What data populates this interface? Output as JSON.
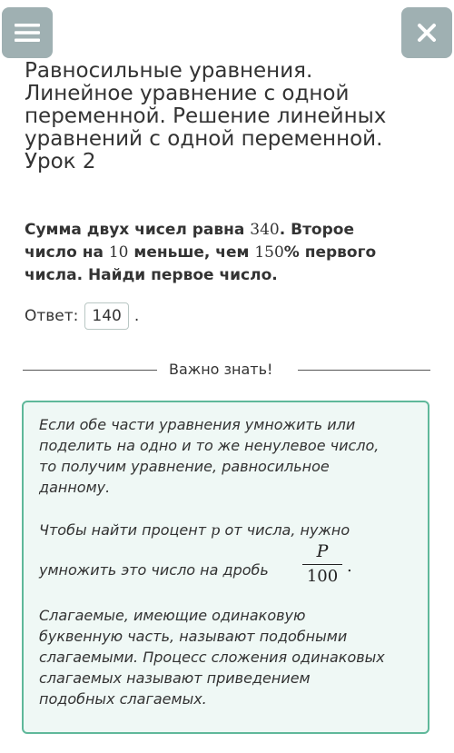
{
  "header": {
    "menu_icon": "menu-icon",
    "close_icon": "close-icon",
    "button_color": "#9fb0b2"
  },
  "title_lines": [
    "Равносильные уравнения.",
    "Линейное уравнение с одной",
    "переменной. Решение линейных",
    "уравнений с одной переменной.",
    "Урок 2"
  ],
  "question": {
    "l1_a": "Сумма двух чисел равна ",
    "l1_n": "340",
    "l1_b": ". Второе",
    "l2_a": "число на ",
    "l2_n": "10",
    "l2_b": " меньше, чем ",
    "l2_n2": "150",
    "l2_c": "% первого",
    "l3": "числа. Найди первое число."
  },
  "answer": {
    "label": "Ответ:",
    "value": "140",
    "suffix": "."
  },
  "divider": {
    "label": "Важно знать!"
  },
  "info": {
    "border_color": "#5fb89a",
    "background": "#eff8f5",
    "p1": [
      "Если обе части уравнения умножить или",
      "поделить на одно и то же ненулевое число,",
      "то получим уравнение, равносильное",
      "данному."
    ],
    "p2_a": "Чтобы найти процент ",
    "p2_var": "p",
    "p2_b": " от числа, нужно",
    "p2_line2": "умножить это число на дробь",
    "fraction_num": "P",
    "fraction_den": "100",
    "fraction_dot": ".",
    "p3": [
      "Слагаемые, имеющие одинаковую",
      "буквенную часть, называют подобными",
      "слагаемыми. Процесс сложения одинаковых",
      "слагаемых называют приведением",
      "подобных слагаемых."
    ]
  }
}
